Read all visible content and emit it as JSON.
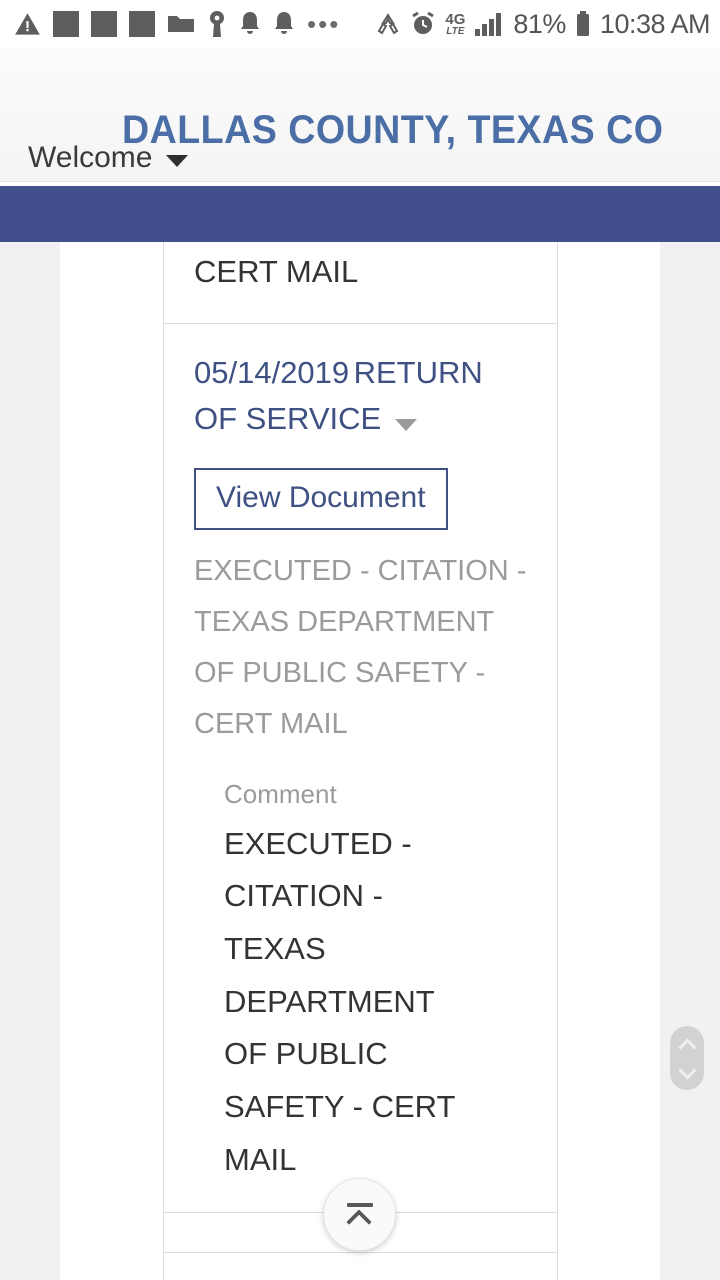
{
  "status_bar": {
    "icons_left": [
      "warning-triangle-icon",
      "app-square-icon-1",
      "app-square-icon-2",
      "app-square-icon-3",
      "folder-icon",
      "key-icon",
      "notification-bell-icon-1",
      "notification-bell-icon-2",
      "more-dots-icon"
    ],
    "icons_right": [
      "data-saver-icon",
      "alarm-clock-icon",
      "network-4g-lte-icon",
      "signal-bars-icon",
      "battery-icon"
    ],
    "network_label_top": "4G",
    "network_label_bottom": "LTE",
    "battery_percent": "81%",
    "time": "10:38 AM"
  },
  "header": {
    "title": "DALLAS COUNTY, TEXAS CO",
    "title_color": "#4a6ea5",
    "welcome_label": "Welcome",
    "welcome_caret_icon": "chevron-down-icon"
  },
  "navbar": {
    "background_color": "#41508c"
  },
  "content": {
    "previous_row_text": "CERT MAIL",
    "entry": {
      "date": "05/14/2019",
      "title": "RETURN OF SERVICE",
      "title_caret_icon": "chevron-down-icon",
      "view_document_label": "View Document",
      "description": "EXECUTED - CITATION - TEXAS DEPARTMENT OF PUBLIC SAFETY - CERT MAIL",
      "comment_label": "Comment",
      "comment_value": "EXECUTED - CITATION - TEXAS DEPARTMENT OF PUBLIC SAFETY - CERT MAIL"
    }
  },
  "controls": {
    "scroll_handle_icon_up": "chevron-up-icon",
    "scroll_handle_icon_down": "chevron-down-icon",
    "scroll_to_top_icon": "scroll-to-top-icon"
  }
}
